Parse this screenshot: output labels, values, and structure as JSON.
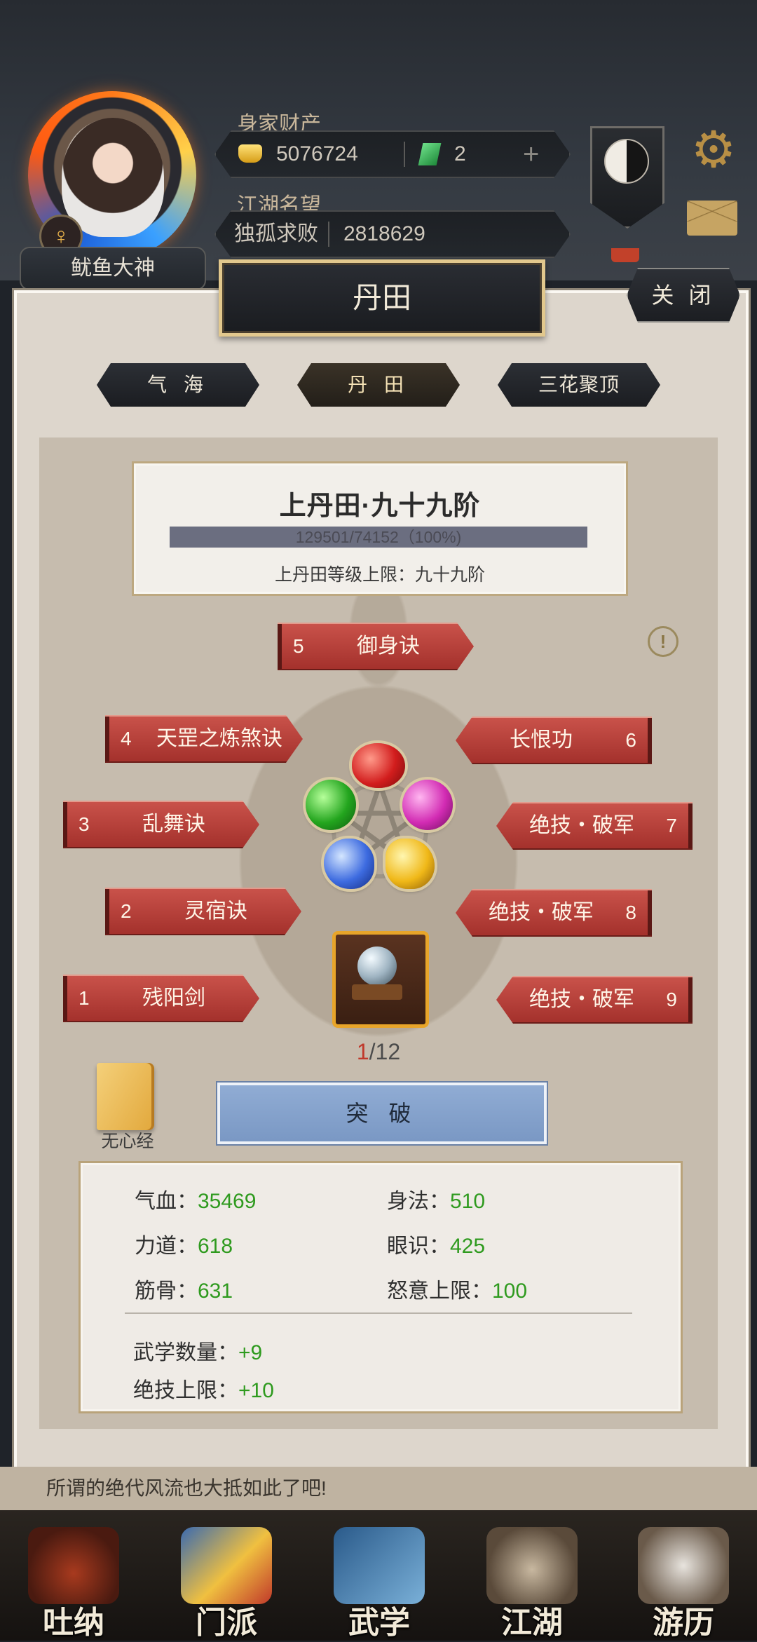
{
  "header": {
    "nickname": "鱿鱼大神",
    "gender_symbol": "♀",
    "wealth_label": "身家财产",
    "gold": "5076724",
    "jade": "2",
    "add_symbol": "+",
    "fame_label": "江湖名望",
    "fame_title": "独孤求败",
    "fame_value": "2818629",
    "gear_symbol": "⚙"
  },
  "panel": {
    "title": "丹田",
    "close_label": "关 闭",
    "tabs": [
      {
        "label": "气 海"
      },
      {
        "label": "丹 田"
      },
      {
        "label": "三花聚顶"
      }
    ],
    "active_tab": 1,
    "level_title": "上丹田·九十九阶",
    "exp_text": "129501/74152（100%)",
    "exp_fraction": 1.0,
    "level_cap": "上丹田等级上限：九十九阶",
    "info_symbol": "!"
  },
  "skills": [
    {
      "num": "1",
      "name": "残阳剑"
    },
    {
      "num": "2",
      "name": "灵宿诀"
    },
    {
      "num": "3",
      "name": "乱舞诀"
    },
    {
      "num": "4",
      "name": "天罡之炼煞诀"
    },
    {
      "num": "5",
      "name": "御身诀"
    },
    {
      "num": "6",
      "name": "长恨功"
    },
    {
      "num": "7",
      "name": "绝技・破军"
    },
    {
      "num": "8",
      "name": "绝技・破军"
    },
    {
      "num": "9",
      "name": "绝技・破军"
    }
  ],
  "progress": {
    "current": "1",
    "total": "/12"
  },
  "manual_label": "无心经",
  "breakthrough_label": "突 破",
  "stats": {
    "hp_label": "气血：",
    "hp": "35469",
    "agility_label": "身法：",
    "agility": "510",
    "strength_label": "力道：",
    "strength": "618",
    "insight_label": "眼识：",
    "insight": "425",
    "constitution_label": "筋骨：",
    "constitution": "631",
    "rage_label": "怒意上限：",
    "rage": "100",
    "martial_count_label": "武学数量：",
    "martial_count": "+9",
    "ultimate_cap_label": "绝技上限：",
    "ultimate_cap": "+10"
  },
  "story_text": "所谓的绝代风流也大抵如此了吧!",
  "nav": [
    {
      "label": "吐纳"
    },
    {
      "label": "门派"
    },
    {
      "label": "武学"
    },
    {
      "label": "江湖"
    },
    {
      "label": "游历"
    }
  ],
  "colors": {
    "skill_red": "#b8403a",
    "stat_green": "#2e9a1e",
    "title_gold": "#e2c88d",
    "button_blue": "#85a2cc"
  }
}
